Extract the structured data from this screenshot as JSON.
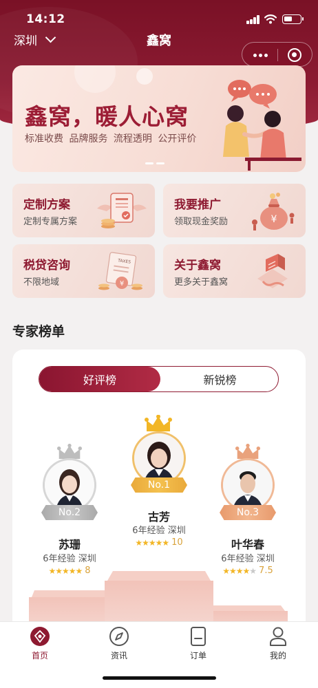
{
  "status_bar": {
    "time": "14:12"
  },
  "nav": {
    "city": "深圳",
    "title": "鑫窝"
  },
  "banner": {
    "title": "鑫窝，暖人心窝",
    "subtitle": "标准收费  品牌服务  流程透明  公开评价"
  },
  "cards": [
    {
      "title": "定制方案",
      "subtitle": "定制专属方案",
      "icon": "document-coins-icon"
    },
    {
      "title": "我要推广",
      "subtitle": "领取现金奖励",
      "icon": "money-bag-icon"
    },
    {
      "title": "税贷咨询",
      "subtitle": "不限地域",
      "icon": "taxes-coin-icon"
    },
    {
      "title": "关于鑫窝",
      "subtitle": "更多关于鑫窝",
      "icon": "location-building-icon"
    }
  ],
  "experts_section": {
    "title": "专家榜单",
    "tabs": [
      {
        "label": "好评榜",
        "active": true
      },
      {
        "label": "新锐榜",
        "active": false
      }
    ],
    "experts": [
      {
        "rank": "No.1",
        "name": "古芳",
        "meta": "6年经验  深圳",
        "rating": 5,
        "score": "10",
        "crown_color": "#f2b626"
      },
      {
        "rank": "No.2",
        "name": "苏珊",
        "meta": "6年经验  深圳",
        "rating": 5,
        "score": "8",
        "crown_color": "#bdbdbd"
      },
      {
        "rank": "No.3",
        "name": "叶华春",
        "meta": "6年经验  深圳",
        "rating": 4,
        "score": "7.5",
        "crown_color": "#e9a27c"
      }
    ]
  },
  "tabbar": [
    {
      "label": "首页",
      "icon": "home-logo-icon",
      "active": true
    },
    {
      "label": "资讯",
      "icon": "compass-icon",
      "active": false
    },
    {
      "label": "订单",
      "icon": "order-icon",
      "active": false
    },
    {
      "label": "我的",
      "icon": "user-icon",
      "active": false
    }
  ],
  "colors": {
    "brand": "#8e1a31",
    "gold": "#f2b626"
  }
}
